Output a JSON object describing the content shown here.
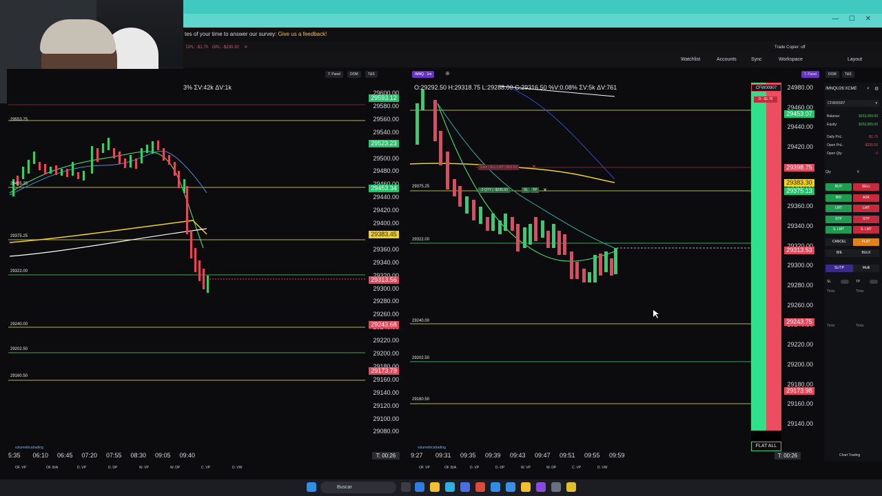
{
  "survey": {
    "text": "tes of your time to answer our survey: ",
    "link": "Give us a feedback!"
  },
  "topbar": {
    "dpl": "DPL: -$1.70",
    "opl": "OPL: -$230.30",
    "trade_copier": "Trade Copier: off"
  },
  "toolbar": {
    "items": [
      "Watchlist",
      "Accounts",
      "Sync",
      "Workspace",
      "Layout"
    ]
  },
  "left_panel": {
    "ohlc": "3% ΣV:42k ΔV:1k",
    "buttons": [
      "T. Panel",
      "DOM",
      "T&S"
    ],
    "price_axis": [
      "29600.00",
      "29580.00",
      "29560.00",
      "29540.00",
      "29520.00",
      "29500.00",
      "29480.00",
      "29460.00",
      "29440.00",
      "29420.00",
      "29400.00",
      "29380.00",
      "29360.00",
      "29340.00",
      "29320.00",
      "29300.00",
      "29280.00",
      "29260.00",
      "29240.00",
      "29220.00",
      "29200.00",
      "29180.00",
      "29160.00",
      "29140.00",
      "29120.00",
      "29100.00",
      "29080.00"
    ],
    "price_boxes": [
      {
        "text": "29593.12",
        "color": "#21c46a"
      },
      {
        "text": "29523.23",
        "color": "#21c46a"
      },
      {
        "text": "29453.34",
        "color": "#21c46a"
      },
      {
        "text": "29383.45",
        "color": "#f2d21b"
      },
      {
        "text": "29313.56",
        "color": "#e8465a"
      },
      {
        "text": "29243.68",
        "color": "#e8465a"
      },
      {
        "text": "29173.79",
        "color": "#e8465a"
      }
    ],
    "levels": [
      "29553.75",
      "29455.25",
      "29375.25",
      "29322.00",
      "29240.00",
      "29202.50",
      "29160.50"
    ],
    "times": [
      "5:35",
      "06:10",
      "06:45",
      "07:20",
      "07:55",
      "08:30",
      "09:05",
      "09:40"
    ],
    "timer": "T: 00:26",
    "bottom_items": [
      "OF. VP",
      "OF. B/A",
      "D. VP",
      "D. DP",
      "W. VP",
      "W. DP",
      "C. VP",
      "D. VW"
    ],
    "brand": "volumetricatrading"
  },
  "right_panel": {
    "symbol": "/MNQ",
    "interval": "1m",
    "ohlc": "O:29292.50 H:29318.75 L:29288.00 C:29316.50 %V:0.08% ΣV:5k ΔV:761",
    "buttons": [
      "T. Panel",
      "DOM",
      "T&S"
    ],
    "price_axis": [
      "24980.00",
      "29460.00",
      "29440.00",
      "29420.00",
      "29400.00",
      "29380.00",
      "29360.00",
      "29340.00",
      "29320.00",
      "29300.00",
      "29280.00",
      "29260.00",
      "29240.00",
      "29220.00",
      "29200.00",
      "29180.00",
      "29160.00",
      "29140.00"
    ],
    "price_boxes": [
      {
        "text": "29453.07",
        "color": "#21c46a"
      },
      {
        "text": "29398.75",
        "color": "#e8465a"
      },
      {
        "text": "29383.30",
        "color": "#f2d21b"
      },
      {
        "text": "29375.13",
        "color": "#21c46a"
      },
      {
        "text": "29313.53",
        "color": "#e8465a"
      },
      {
        "text": "29243.75",
        "color": "#e8465a"
      },
      {
        "text": "29173.98",
        "color": "#e8465a"
      }
    ],
    "levels": [
      "29375.25",
      "29322.00",
      "29240.00",
      "29202.50",
      "29160.50"
    ],
    "order_labels": [
      "Sam | ALL LMT | $54.50",
      "-2 QTY | -$235.50",
      "SL",
      "TP"
    ],
    "times": [
      "9:27",
      "09:31",
      "09:35",
      "09:39",
      "09:43",
      "09:47",
      "09:51",
      "09:55",
      "09:59"
    ],
    "timer": "T: 00:26",
    "account_tag": "CFW00907",
    "pnl_tag": "D: -$1.70",
    "flat_all": "FLAT ALL",
    "bottom_items": [
      "OF. VP",
      "OF. B/A",
      "D. VP",
      "D. DP",
      "W. VP",
      "W. DP",
      "C. VP",
      "D. VW"
    ],
    "brand": "volumetricatrading"
  },
  "side_panel": {
    "symbol": "/MNQU26:XCME",
    "account": "CFW00907",
    "rows": [
      {
        "label": "Balance:",
        "value": "$153,000.00"
      },
      {
        "label": "Equity:",
        "value": "$152,805.00"
      },
      {
        "label": "Daily PnL:",
        "value": "-$1.70"
      },
      {
        "label": "Open PnL:",
        "value": "-$235.50"
      },
      {
        "label": "Open Qty:",
        "value": "-2"
      }
    ],
    "qty_label": "Qty",
    "qty_value": "6",
    "buy_buttons": [
      "BUY",
      "BID",
      "LMT",
      "STP",
      "S. LMT"
    ],
    "sell_buttons": [
      "SELL",
      "ASK",
      "LMT",
      "STP",
      "S. LMT"
    ],
    "cancel": "CANCEL",
    "flat": "FLAT",
    "be": "B/E",
    "bulk": "BULK",
    "sltp": "SL/TP",
    "multi": "Multi",
    "sl": "SL",
    "tp": "TP",
    "ticks": "Ticks",
    "chart_trading": "Chart Trading"
  },
  "taskbar": {
    "search": "Buscar"
  }
}
